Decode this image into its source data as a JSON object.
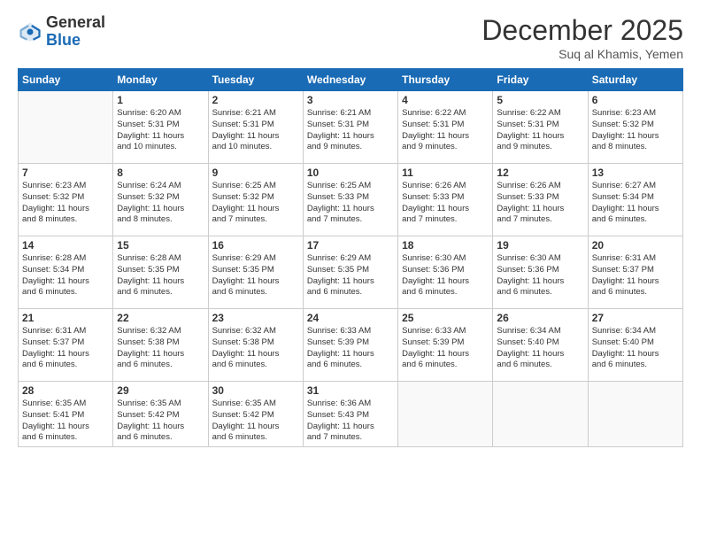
{
  "logo": {
    "general": "General",
    "blue": "Blue"
  },
  "header": {
    "month": "December 2025",
    "location": "Suq al Khamis, Yemen"
  },
  "days": [
    "Sunday",
    "Monday",
    "Tuesday",
    "Wednesday",
    "Thursday",
    "Friday",
    "Saturday"
  ],
  "weeks": [
    [
      {
        "day": "",
        "info": ""
      },
      {
        "day": "1",
        "info": "Sunrise: 6:20 AM\nSunset: 5:31 PM\nDaylight: 11 hours\nand 10 minutes."
      },
      {
        "day": "2",
        "info": "Sunrise: 6:21 AM\nSunset: 5:31 PM\nDaylight: 11 hours\nand 10 minutes."
      },
      {
        "day": "3",
        "info": "Sunrise: 6:21 AM\nSunset: 5:31 PM\nDaylight: 11 hours\nand 9 minutes."
      },
      {
        "day": "4",
        "info": "Sunrise: 6:22 AM\nSunset: 5:31 PM\nDaylight: 11 hours\nand 9 minutes."
      },
      {
        "day": "5",
        "info": "Sunrise: 6:22 AM\nSunset: 5:31 PM\nDaylight: 11 hours\nand 9 minutes."
      },
      {
        "day": "6",
        "info": "Sunrise: 6:23 AM\nSunset: 5:32 PM\nDaylight: 11 hours\nand 8 minutes."
      }
    ],
    [
      {
        "day": "7",
        "info": "Sunrise: 6:23 AM\nSunset: 5:32 PM\nDaylight: 11 hours\nand 8 minutes."
      },
      {
        "day": "8",
        "info": "Sunrise: 6:24 AM\nSunset: 5:32 PM\nDaylight: 11 hours\nand 8 minutes."
      },
      {
        "day": "9",
        "info": "Sunrise: 6:25 AM\nSunset: 5:32 PM\nDaylight: 11 hours\nand 7 minutes."
      },
      {
        "day": "10",
        "info": "Sunrise: 6:25 AM\nSunset: 5:33 PM\nDaylight: 11 hours\nand 7 minutes."
      },
      {
        "day": "11",
        "info": "Sunrise: 6:26 AM\nSunset: 5:33 PM\nDaylight: 11 hours\nand 7 minutes."
      },
      {
        "day": "12",
        "info": "Sunrise: 6:26 AM\nSunset: 5:33 PM\nDaylight: 11 hours\nand 7 minutes."
      },
      {
        "day": "13",
        "info": "Sunrise: 6:27 AM\nSunset: 5:34 PM\nDaylight: 11 hours\nand 6 minutes."
      }
    ],
    [
      {
        "day": "14",
        "info": "Sunrise: 6:28 AM\nSunset: 5:34 PM\nDaylight: 11 hours\nand 6 minutes."
      },
      {
        "day": "15",
        "info": "Sunrise: 6:28 AM\nSunset: 5:35 PM\nDaylight: 11 hours\nand 6 minutes."
      },
      {
        "day": "16",
        "info": "Sunrise: 6:29 AM\nSunset: 5:35 PM\nDaylight: 11 hours\nand 6 minutes."
      },
      {
        "day": "17",
        "info": "Sunrise: 6:29 AM\nSunset: 5:35 PM\nDaylight: 11 hours\nand 6 minutes."
      },
      {
        "day": "18",
        "info": "Sunrise: 6:30 AM\nSunset: 5:36 PM\nDaylight: 11 hours\nand 6 minutes."
      },
      {
        "day": "19",
        "info": "Sunrise: 6:30 AM\nSunset: 5:36 PM\nDaylight: 11 hours\nand 6 minutes."
      },
      {
        "day": "20",
        "info": "Sunrise: 6:31 AM\nSunset: 5:37 PM\nDaylight: 11 hours\nand 6 minutes."
      }
    ],
    [
      {
        "day": "21",
        "info": "Sunrise: 6:31 AM\nSunset: 5:37 PM\nDaylight: 11 hours\nand 6 minutes."
      },
      {
        "day": "22",
        "info": "Sunrise: 6:32 AM\nSunset: 5:38 PM\nDaylight: 11 hours\nand 6 minutes."
      },
      {
        "day": "23",
        "info": "Sunrise: 6:32 AM\nSunset: 5:38 PM\nDaylight: 11 hours\nand 6 minutes."
      },
      {
        "day": "24",
        "info": "Sunrise: 6:33 AM\nSunset: 5:39 PM\nDaylight: 11 hours\nand 6 minutes."
      },
      {
        "day": "25",
        "info": "Sunrise: 6:33 AM\nSunset: 5:39 PM\nDaylight: 11 hours\nand 6 minutes."
      },
      {
        "day": "26",
        "info": "Sunrise: 6:34 AM\nSunset: 5:40 PM\nDaylight: 11 hours\nand 6 minutes."
      },
      {
        "day": "27",
        "info": "Sunrise: 6:34 AM\nSunset: 5:40 PM\nDaylight: 11 hours\nand 6 minutes."
      }
    ],
    [
      {
        "day": "28",
        "info": "Sunrise: 6:35 AM\nSunset: 5:41 PM\nDaylight: 11 hours\nand 6 minutes."
      },
      {
        "day": "29",
        "info": "Sunrise: 6:35 AM\nSunset: 5:42 PM\nDaylight: 11 hours\nand 6 minutes."
      },
      {
        "day": "30",
        "info": "Sunrise: 6:35 AM\nSunset: 5:42 PM\nDaylight: 11 hours\nand 6 minutes."
      },
      {
        "day": "31",
        "info": "Sunrise: 6:36 AM\nSunset: 5:43 PM\nDaylight: 11 hours\nand 7 minutes."
      },
      {
        "day": "",
        "info": ""
      },
      {
        "day": "",
        "info": ""
      },
      {
        "day": "",
        "info": ""
      }
    ]
  ]
}
